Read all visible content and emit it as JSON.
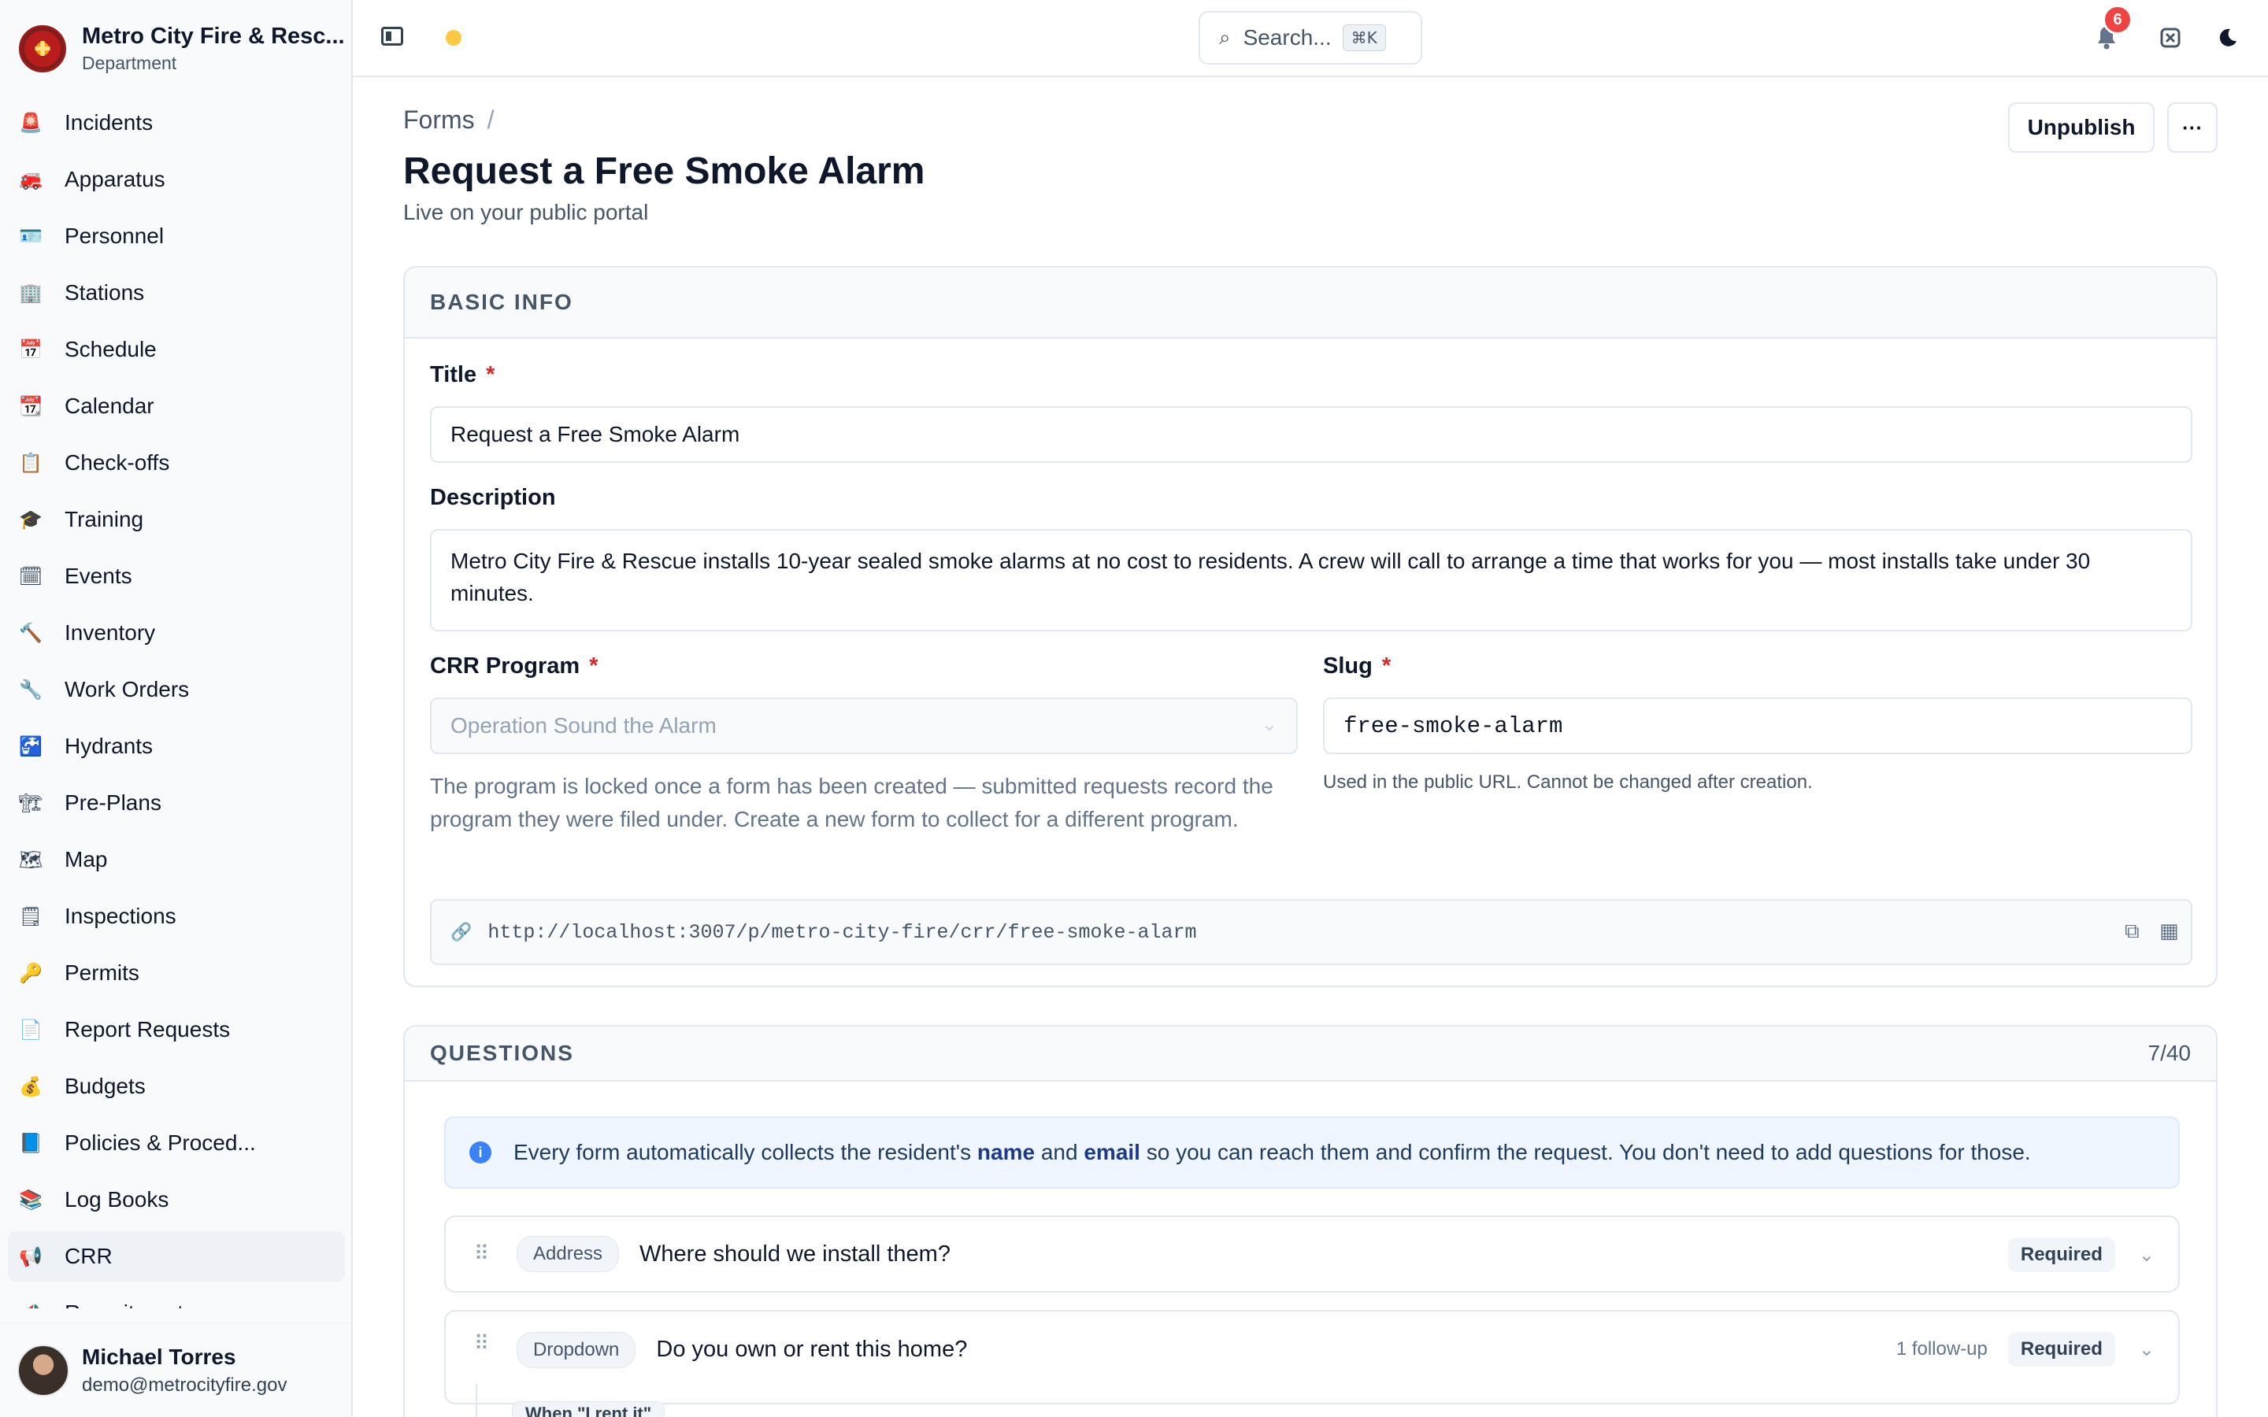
{
  "org": {
    "name": "Metro City Fire & Resc...",
    "subtitle": "Department"
  },
  "nav": [
    {
      "label": "Incidents",
      "icon": "🚨",
      "active": false
    },
    {
      "label": "Apparatus",
      "icon": "🚒",
      "active": false
    },
    {
      "label": "Personnel",
      "icon": "🪪",
      "active": false
    },
    {
      "label": "Stations",
      "icon": "🏢",
      "active": false
    },
    {
      "label": "Schedule",
      "icon": "📅",
      "active": false
    },
    {
      "label": "Calendar",
      "icon": "📆",
      "active": false
    },
    {
      "label": "Check-offs",
      "icon": "📋",
      "active": false
    },
    {
      "label": "Training",
      "icon": "🎓",
      "active": false
    },
    {
      "label": "Events",
      "icon": "🗓",
      "active": false
    },
    {
      "label": "Inventory",
      "icon": "🔨",
      "active": false
    },
    {
      "label": "Work Orders",
      "icon": "🔧",
      "active": false
    },
    {
      "label": "Hydrants",
      "icon": "🚰",
      "active": false
    },
    {
      "label": "Pre-Plans",
      "icon": "🏗",
      "active": false
    },
    {
      "label": "Map",
      "icon": "🗺",
      "active": false
    },
    {
      "label": "Inspections",
      "icon": "🗒",
      "active": false
    },
    {
      "label": "Permits",
      "icon": "🔑",
      "active": false
    },
    {
      "label": "Report Requests",
      "icon": "📄",
      "active": false
    },
    {
      "label": "Budgets",
      "icon": "💰",
      "active": false
    },
    {
      "label": "Policies & Proced...",
      "icon": "📘",
      "active": false
    },
    {
      "label": "Log Books",
      "icon": "📚",
      "active": false
    },
    {
      "label": "CRR",
      "icon": "📢",
      "active": true
    },
    {
      "label": "Recruitment",
      "icon": "📣",
      "active": false
    }
  ],
  "user": {
    "name": "Michael Torres",
    "email": "demo@metrocityfire.gov"
  },
  "topbar": {
    "search_placeholder": "Search...",
    "search_shortcut": "⌘K",
    "notification_count": "6"
  },
  "header": {
    "breadcrumb": "Forms",
    "breadcrumb_sep": "/",
    "title": "Request a Free Smoke Alarm",
    "subtitle": "Live on your public portal",
    "unpublish_label": "Unpublish",
    "more_label": "···"
  },
  "basic_info": {
    "section_title": "BASIC INFO",
    "title_label": "Title",
    "title_value": "Request a Free Smoke Alarm",
    "description_label": "Description",
    "description_value": "Metro City Fire & Rescue installs 10-year sealed smoke alarms at no cost to residents. A crew will call to arrange a time that works for you — most installs take under 30 minutes.",
    "program_label": "CRR Program",
    "program_value": "Operation Sound the Alarm",
    "program_help": "The program is locked once a form has been created — submitted requests record the program they were filed under. Create a new form to collect for a different program.",
    "slug_label": "Slug",
    "slug_value": "free-smoke-alarm",
    "slug_help": "Used in the public URL. Cannot be changed after creation.",
    "public_url": "http://localhost:3007/p/metro-city-fire/crr/free-smoke-alarm",
    "required_marker": "*"
  },
  "questions": {
    "section_title": "QUESTIONS",
    "count": "7/40",
    "info_prefix": "Every form automatically collects the resident's ",
    "info_name": "name",
    "info_and": " and ",
    "info_email": "email",
    "info_suffix": " so you can reach them and confirm the request. You don't need to add questions for those.",
    "items": [
      {
        "type": "Address",
        "text": "Where should we install them?",
        "followup": "",
        "required": "Required"
      },
      {
        "type": "Dropdown",
        "text": "Do you own or rent this home?",
        "followup": "1 follow-up",
        "required": "Required"
      }
    ],
    "condition_label": "When \"I rent it\""
  }
}
